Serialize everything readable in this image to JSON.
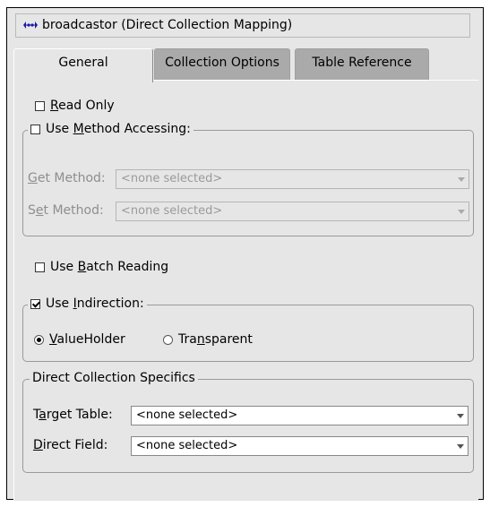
{
  "window": {
    "title": "broadcastor (Direct Collection Mapping)",
    "icon": "mapping-icon"
  },
  "tabs": [
    {
      "label": "General",
      "active": true
    },
    {
      "label": "Collection Options",
      "active": false
    },
    {
      "label": "Table Reference",
      "active": false
    }
  ],
  "general": {
    "read_only": {
      "label_mn": "R",
      "label_rest": "ead Only",
      "checked": false
    },
    "method_accessing": {
      "label_pre": "Use ",
      "label_mn": "M",
      "label_rest": "ethod Accessing:",
      "checked": false
    },
    "get_method": {
      "label_mn": "G",
      "label_rest": "et Method:",
      "value": "<none selected>",
      "enabled": false
    },
    "set_method": {
      "label_pre": "S",
      "label_mn": "e",
      "label_rest": "t Method:",
      "value": "<none selected>",
      "enabled": false
    },
    "batch_reading": {
      "label_pre": "Use ",
      "label_mn": "B",
      "label_rest": "atch Reading",
      "checked": false
    },
    "indirection": {
      "label_pre": "Use ",
      "label_mn": "I",
      "label_rest": "ndirection:",
      "checked": true
    },
    "value_holder": {
      "label_mn": "V",
      "label_rest": "alueHolder",
      "selected": true
    },
    "transparent": {
      "label_pre": "Tra",
      "label_mn": "n",
      "label_rest": "sparent",
      "selected": false
    },
    "specifics": {
      "legend": "Direct Collection Specifics",
      "target_table": {
        "label_pre": "T",
        "label_mn": "a",
        "label_rest": "rget Table:",
        "value": "<none selected>"
      },
      "direct_field": {
        "label_mn": "D",
        "label_rest": "irect Field:",
        "value": "<none selected>"
      }
    }
  },
  "colors": {
    "background": "#e6e6e6",
    "tab_inactive": "#aaaaaa",
    "disabled_text": "#8e8e8e"
  }
}
